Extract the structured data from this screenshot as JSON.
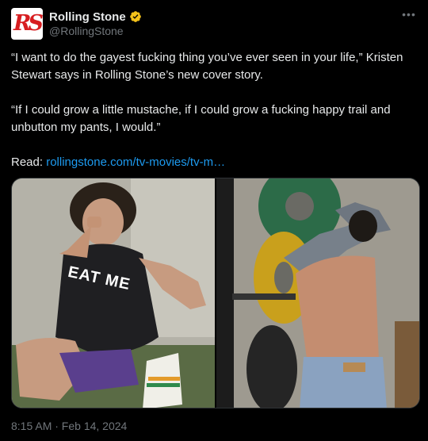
{
  "author": {
    "display_name": "Rolling Stone",
    "handle": "@RollingStone",
    "avatar_icon": "rolling-stone-logo",
    "avatar_mark": "RS",
    "verified_icon": "verified-badge-icon",
    "verified_color": "#f4c21a"
  },
  "more_icon": "more-options-icon",
  "post": {
    "paragraphs": [
      "“I want to do the gayest fucking thing you’ve ever seen in your life,” Kristen Stewart says in Rolling Stone’s new cover story.",
      "“If I could grow a little mustache, if I could grow a fucking happy trail and unbutton my pants, I would.”"
    ],
    "read_label": "Read: ",
    "link_text": "rollingstone.com/tv-movies/tv-m…"
  },
  "media": {
    "left_photo_shirt_text": "EAT ME"
  },
  "timestamp": "8:15 AM · Feb 14, 2024",
  "colors": {
    "background": "#000000",
    "text": "#e7e9ea",
    "secondary": "#71767b",
    "link": "#1d9bf0",
    "brand_red": "#d71d20"
  }
}
